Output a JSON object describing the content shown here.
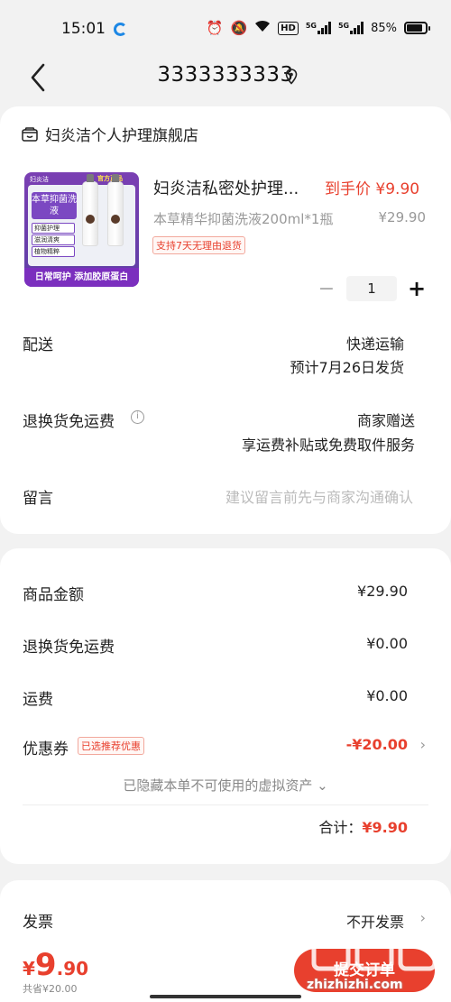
{
  "status_bar": {
    "time": "15:01",
    "net_5g_1": "5G",
    "net_5g_2": "5G",
    "hd": "HD",
    "battery": "85%",
    "battery_level": 0.85
  },
  "header": {
    "title": "3333333333"
  },
  "store": {
    "name": "妇炎洁个人护理旗舰店"
  },
  "product": {
    "image": {
      "brand": "妇炎洁",
      "official": "官方正品",
      "main_tag": "本草抑菌洗液",
      "tags": [
        "抑菌护理",
        "滋润清爽",
        "植物精粹"
      ],
      "footer": "日常呵护 添加胶原蛋白"
    },
    "name": "妇炎洁私密处护理...",
    "price_label": "到手价 ¥9.90",
    "spec": "本草精华抑菌洗液200ml*1瓶",
    "original_price": "¥29.90",
    "badge": "支持7天无理由退货",
    "quantity": "1",
    "minus": "−",
    "plus": "+"
  },
  "delivery": {
    "label": "配送",
    "method": "快递运输",
    "eta": "预计7月26日发货"
  },
  "return_shipping": {
    "label": "退换货免运费",
    "value": "商家赠送",
    "detail": "享运费补贴或免费取件服务"
  },
  "message": {
    "label": "留言",
    "placeholder": "建议留言前先与商家沟通确认"
  },
  "summary": {
    "goods_label": "商品金额",
    "goods_value": "¥29.90",
    "return_label": "退换货免运费",
    "return_value": "¥0.00",
    "shipping_label": "运费",
    "shipping_value": "¥0.00",
    "coupon_label": "优惠券",
    "coupon_tag": "已选推荐优惠",
    "coupon_value": "-¥20.00",
    "hidden_note": "已隐藏本单不可使用的虚拟资产 ⌄",
    "total_label": "合计：",
    "total_value": "¥9.90"
  },
  "invoice": {
    "label": "发票",
    "value": "不开发票"
  },
  "footer": {
    "currency": "¥",
    "pay_int": "9",
    "pay_dec": ".90",
    "saved": "共省¥20.00",
    "submit": "提交订单",
    "watermark": "zhizhizhi.com"
  },
  "colors": {
    "accent": "#e8402e",
    "background": "#f2f2f2"
  }
}
